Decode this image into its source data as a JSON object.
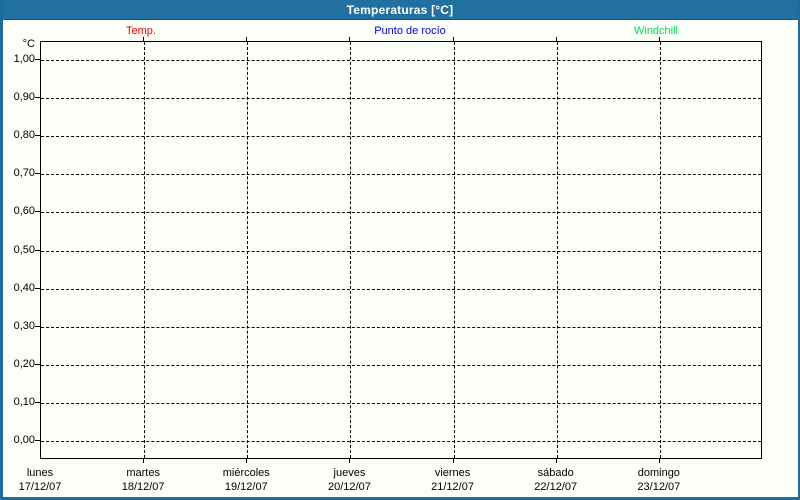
{
  "header": {
    "title": "Temperaturas [°C]"
  },
  "legend": {
    "items": [
      {
        "label": "Temp.",
        "color": "#ee0000",
        "center_x": 141
      },
      {
        "label": "Punto de rocío",
        "color": "#0000ee",
        "center_x": 410
      },
      {
        "label": "Windchill",
        "color": "#00dd55",
        "center_x": 656
      }
    ]
  },
  "colors": {
    "header_bg": "#1d6d9e",
    "frame": "#1d6d9e",
    "plot_bg": "#fcfef8",
    "grid": "#000000"
  },
  "chart_data": {
    "type": "line",
    "title": "Temperaturas [°C]",
    "xlabel": "",
    "ylabel": "°C",
    "ylim": [
      0.0,
      1.0
    ],
    "ytick_step": 0.1,
    "yticks": [
      "1,00",
      "0,90",
      "0,80",
      "0,70",
      "0,60",
      "0,50",
      "0,40",
      "0,30",
      "0,20",
      "0,10",
      "0,00"
    ],
    "grid": "dashed",
    "legend_position": "top",
    "x_categories": [
      {
        "day": "lunes",
        "date": "17/12/07"
      },
      {
        "day": "martes",
        "date": "18/12/07"
      },
      {
        "day": "miércoles",
        "date": "19/12/07"
      },
      {
        "day": "jueves",
        "date": "20/12/07"
      },
      {
        "day": "viernes",
        "date": "21/12/07"
      },
      {
        "day": "sábado",
        "date": "22/12/07"
      },
      {
        "day": "domingo",
        "date": "23/12/07"
      }
    ],
    "series": [
      {
        "name": "Temp.",
        "color": "#ee0000",
        "values": []
      },
      {
        "name": "Punto de rocío",
        "color": "#0000ee",
        "values": []
      },
      {
        "name": "Windchill",
        "color": "#00dd55",
        "values": []
      }
    ]
  }
}
